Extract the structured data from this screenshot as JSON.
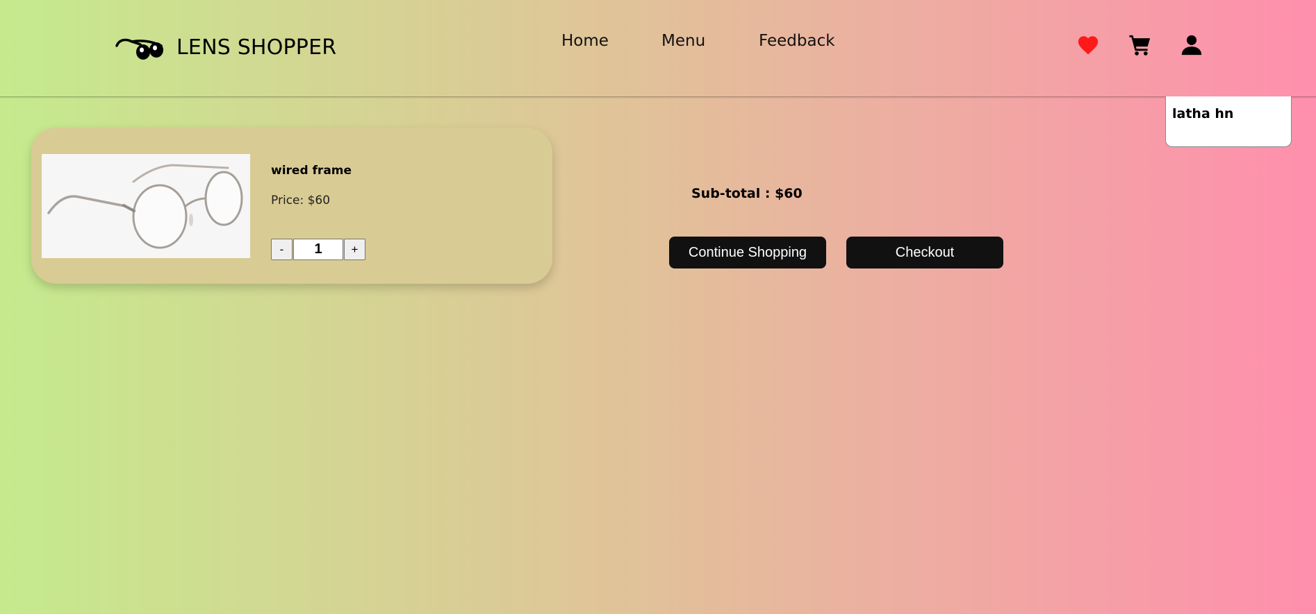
{
  "header": {
    "brand": "LENS SHOPPER",
    "logo_icon": "glasses-icon",
    "nav": [
      {
        "label": "Home"
      },
      {
        "label": "Menu"
      },
      {
        "label": "Feedback"
      }
    ],
    "icons": {
      "wishlist": "heart-icon",
      "cart": "cart-icon",
      "account": "user-icon"
    },
    "wishlist_color": "#ff1a1a"
  },
  "user_popup": {
    "name": "latha hn"
  },
  "cart": {
    "items": [
      {
        "name": "wired frame",
        "price_text": "Price: $60",
        "quantity": "1",
        "decrement_label": "-",
        "increment_label": "+"
      }
    ]
  },
  "summary": {
    "subtotal_text": "Sub-total : $60",
    "continue_label": "Continue Shopping",
    "checkout_label": "Checkout"
  },
  "colors": {
    "gradient_start": "#c5ea8d",
    "gradient_end": "#ff8fad",
    "card_bg": "#d9cb94",
    "button_bg": "#111111"
  }
}
